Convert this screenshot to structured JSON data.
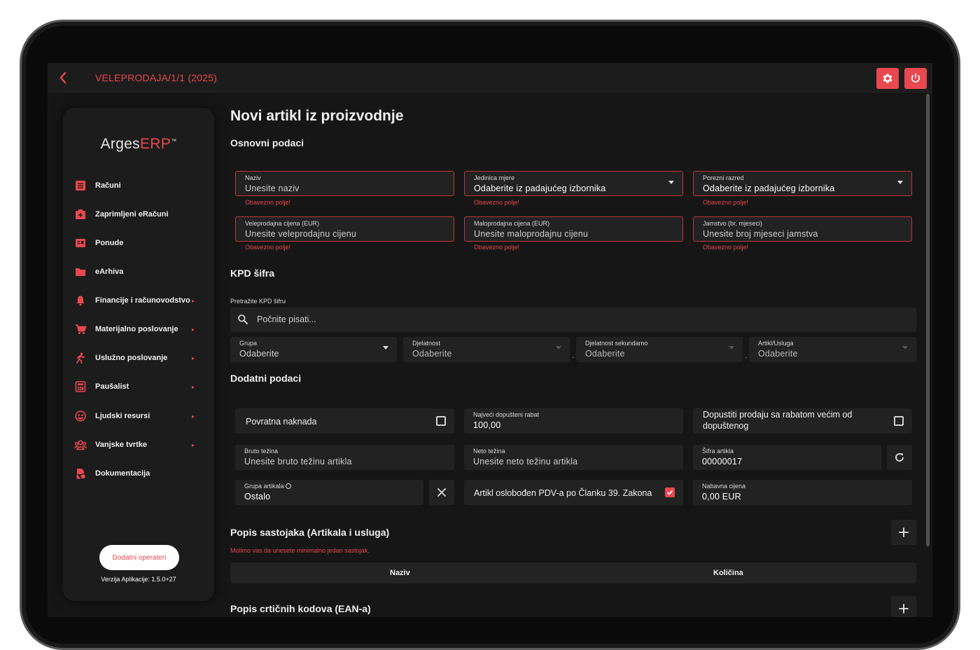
{
  "topbar": {
    "title": "VELEPRODAJA/1/1 (2025)"
  },
  "sidebar": {
    "logo_main": "Arges",
    "logo_accent": "ERP",
    "logo_tm": "™",
    "items": [
      {
        "label": "Računi",
        "icon": "receipt-icon",
        "arrow": ""
      },
      {
        "label": "Zaprimljeni eRačuni",
        "icon": "inbox-medical-icon",
        "arrow": ""
      },
      {
        "label": "Ponude",
        "icon": "offer-list-icon",
        "arrow": ""
      },
      {
        "label": "eArhiva",
        "icon": "folder-icon",
        "arrow": ""
      },
      {
        "label": "Financije i računovodstvo",
        "icon": "bell-icon",
        "arrow": "▸"
      },
      {
        "label": "Materijalno poslovanje",
        "icon": "cart-icon",
        "arrow": "▸"
      },
      {
        "label": "Uslužno poslovanje",
        "icon": "running-person-icon",
        "arrow": "▸"
      },
      {
        "label": "Paušalist",
        "icon": "calculator-icon",
        "arrow": "▸"
      },
      {
        "label": "Ljudski resursi",
        "icon": "people-face-icon",
        "arrow": "▸"
      },
      {
        "label": "Vanjske tvrtke",
        "icon": "group-icon",
        "arrow": "▸"
      },
      {
        "label": "Dokumentacija",
        "icon": "document-shield-icon",
        "arrow": ""
      }
    ],
    "operators_button": "Dodatni operateri",
    "version": "Verzija Aplikacije: 1.5.0+27"
  },
  "page": {
    "title": "Novi artikl iz proizvodnje"
  },
  "basic": {
    "title": "Osnovni podaci",
    "required_msg": "Obavezno polje!",
    "naziv": {
      "label": "Naziv",
      "placeholder": "Unesite naziv"
    },
    "jedinica": {
      "label": "Jedinica mjere",
      "placeholder": "Odaberite iz padajućeg izbornika"
    },
    "porezni": {
      "label": "Porezni razred",
      "placeholder": "Odaberite iz padajućeg izbornika"
    },
    "veleprodajna": {
      "label": "Veleprodajna cijena (EUR)",
      "placeholder": "Unesite veleprodajnu cijenu"
    },
    "maloprodajna": {
      "label": "Maloprodajna cijena (EUR)",
      "placeholder": "Unesite maloprodajnu cijenu"
    },
    "jamstvo": {
      "label": "Jamstvo (br. mjeseci)",
      "placeholder": "Unesite broj mjeseci jamstva"
    }
  },
  "kpd": {
    "title": "KPD šifra",
    "search_label": "Pretražite KPD šifru",
    "search_placeholder": "Počnite pisati...",
    "separator": ".",
    "grupa": {
      "label": "Grupa",
      "value": "Odaberite"
    },
    "djelatnost": {
      "label": "Djelatnost",
      "value": "Odaberite"
    },
    "djelatnost_sek": {
      "label": "Djelatnost sekundarno",
      "value": "Odaberite"
    },
    "artikl_usluga": {
      "label": "Artikl/Usluga",
      "value": "Odaberite"
    }
  },
  "additional": {
    "title": "Dodatni podaci",
    "povratna": {
      "label": "Povratna naknada",
      "checked": false
    },
    "rabat": {
      "label": "Najveći dopušteni rabat",
      "value": "100,00"
    },
    "dopusti_line1": "Dopustiti prodaju sa rabatom većim od",
    "dopusti_line2": "dopuštenog",
    "bruto": {
      "label": "Bruto težina",
      "placeholder": "Unesite bruto težinu artikla"
    },
    "neto": {
      "label": "Neto težina",
      "placeholder": "Unesite neto težinu artikla"
    },
    "sifra": {
      "label": "Šifra artikla",
      "value": "00000017"
    },
    "grupa_art": {
      "label": "Grupa artikala",
      "value": "Ostalo"
    },
    "pdv": {
      "label": "Artikl oslobođen PDV-a po Članku 39. Zakona",
      "checked": true
    },
    "nabavna": {
      "label": "Nabavna cijena",
      "value": "0,00 EUR"
    }
  },
  "ingredients": {
    "title": "Popis sastojaka (Artikala i usluga)",
    "error": "Molimo vas da unesete minimalno jedan sastojak.",
    "columns": [
      "Naziv",
      "Količina"
    ]
  },
  "barcodes": {
    "title": "Popis crtičnih kodova (EAN-a)"
  },
  "colors": {
    "accent": "#e8484f",
    "background": "#161616",
    "field": "#222222"
  }
}
